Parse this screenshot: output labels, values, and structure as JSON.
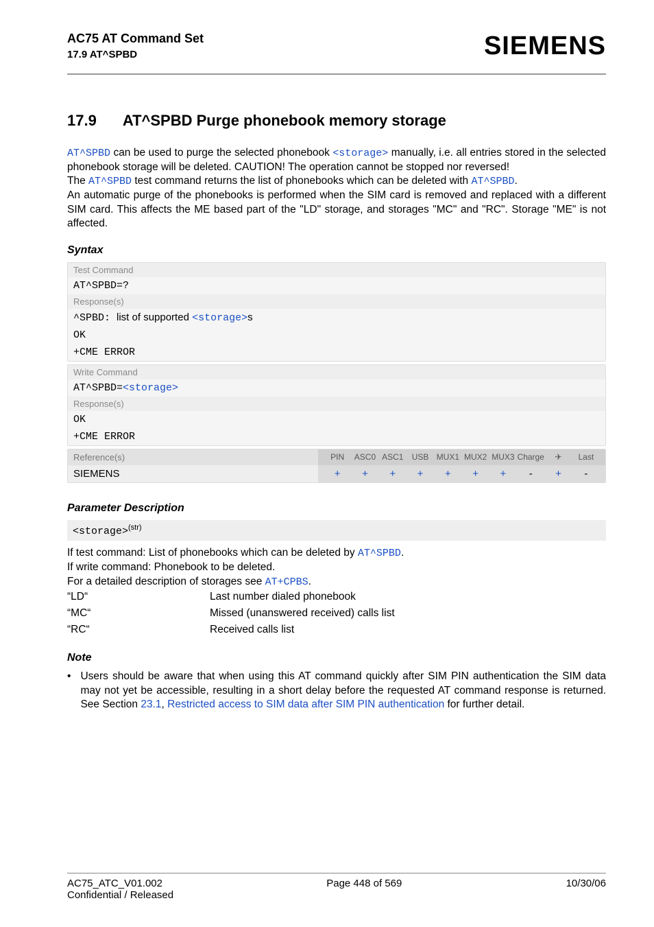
{
  "header": {
    "docTitle": "AC75 AT Command Set",
    "subTitle": "17.9 AT^SPBD",
    "brand": "SIEMENS"
  },
  "section": {
    "number": "17.9",
    "title": "AT^SPBD   Purge phonebook memory storage"
  },
  "intro": {
    "cmd1": "AT^SPBD",
    "t1a": " can be used to purge the selected phonebook ",
    "storageLink": "<storage>",
    "t1b": " manually, i.e. all entries stored in the selected phonebook storage will be deleted. CAUTION! The operation cannot be stopped nor reversed!",
    "t2a": "The ",
    "cmd2": "AT^SPBD",
    "t2b": " test command returns the list of phonebooks which can be deleted with ",
    "cmd3": "AT^SPBD",
    "t2c": ".",
    "t3": "An automatic purge of the phonebooks is performed when the SIM card is removed and replaced with a different SIM card. This affects the ME based part of the \"LD\" storage, and storages \"MC\" and \"RC\". Storage \"ME\" is not affected."
  },
  "syntax": {
    "heading": "Syntax",
    "testLabel": "Test Command",
    "testCmd": "AT^SPBD=?",
    "respLabel": "Response(s)",
    "respA_prefix": "^SPBD: ",
    "respA_mid": "list of supported ",
    "respA_link": "<storage>",
    "respA_suffix": "s",
    "ok": "OK",
    "cme": "+CME ERROR",
    "writeLabel": "Write Command",
    "writeCmdPrefix": "AT^SPBD=",
    "writeCmdLink": "<storage>",
    "refLabel": "Reference(s)",
    "refVendor": "SIEMENS",
    "cols": [
      "PIN",
      "ASC0",
      "ASC1",
      "USB",
      "MUX1",
      "MUX2",
      "MUX3",
      "Charge",
      "✈",
      "Last"
    ],
    "vals": [
      "+",
      "+",
      "+",
      "+",
      "+",
      "+",
      "+",
      "-",
      "+",
      "-"
    ]
  },
  "params": {
    "heading": "Parameter Description",
    "paramName": "<storage>",
    "paramSup": "(str)",
    "desc1a": "If test command: List of phonebooks which can be deleted by ",
    "desc1cmd": "AT^SPBD",
    "desc1b": ".",
    "desc2": "If write command: Phonebook to be deleted.",
    "desc3a": "For a detailed description of storages see ",
    "desc3cmd": "AT+CPBS",
    "desc3b": ".",
    "rows": [
      {
        "k": "“LD“",
        "v": "Last number dialed phonebook"
      },
      {
        "k": "“MC“",
        "v": "Missed (unanswered received) calls list"
      },
      {
        "k": "“RC“",
        "v": "Received calls list"
      }
    ]
  },
  "note": {
    "heading": "Note",
    "bullet": "•",
    "t1": "Users should be aware that when using this AT command quickly after SIM PIN authentication the SIM data may not yet be accessible, resulting in a short delay before the requested AT command response is returned. See Section ",
    "secNum": "23.1",
    "sep": ", ",
    "secTitle": "Restricted access to SIM data after SIM PIN authentication",
    "t2": " for further detail."
  },
  "footer": {
    "left": "AC75_ATC_V01.002",
    "center": "Page 448 of 569",
    "right": "10/30/06",
    "conf": "Confidential / Released"
  }
}
